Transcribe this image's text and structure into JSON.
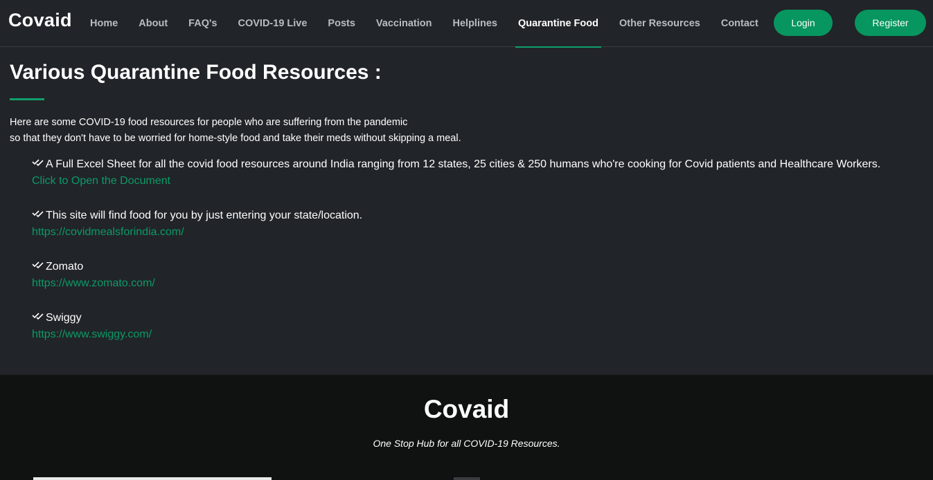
{
  "brand": "Covaid",
  "nav": {
    "items": [
      {
        "label": "Home"
      },
      {
        "label": "About"
      },
      {
        "label": "FAQ's"
      },
      {
        "label": "COVID-19 Live"
      },
      {
        "label": "Posts"
      },
      {
        "label": "Vaccination"
      },
      {
        "label": "Helplines"
      },
      {
        "label": "Quarantine Food",
        "active": true
      },
      {
        "label": "Other Resources"
      },
      {
        "label": "Contact"
      }
    ],
    "login_label": "Login",
    "register_label": "Register"
  },
  "main": {
    "title": "Various Quarantine Food Resources :",
    "intro_line1": "Here are some COVID-19 food resources for people who are suffering from the pandemic",
    "intro_line2": "so that they don't have to be worried for home-style food and take their meds without skipping a meal.",
    "resources": [
      {
        "text": "A Full Excel Sheet for all the covid food resources around India ranging from 12 states, 25 cities & 250 humans who're cooking for Covid patients and Healthcare Workers.",
        "link": "Click to Open the Document"
      },
      {
        "text": "This site will find food for you by just entering your state/location.",
        "link": "https://covidmealsforindia.com/"
      },
      {
        "text": "Zomato",
        "link": "https://www.zomato.com/"
      },
      {
        "text": "Swiggy",
        "link": "https://www.swiggy.com/"
      }
    ]
  },
  "footer": {
    "brand": "Covaid",
    "tagline": "One Stop Hub for all COVID-19 Resources."
  },
  "colors": {
    "accent": "#07965f",
    "link": "#0c9a66",
    "background": "#212428",
    "footer_background": "#101111"
  },
  "icons": {
    "bullet": "double-check-icon"
  }
}
